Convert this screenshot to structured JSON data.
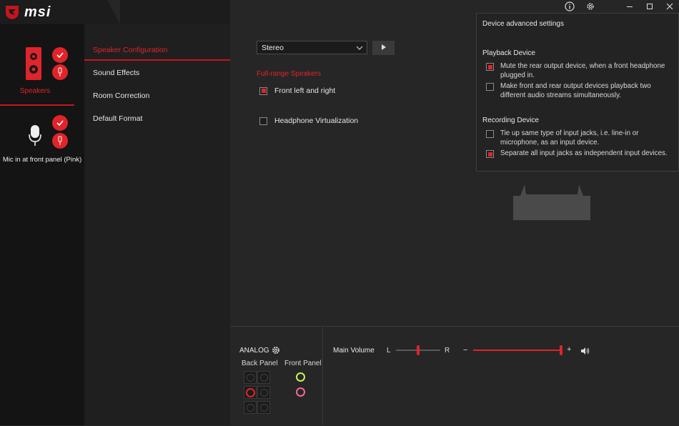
{
  "app": {
    "brand": "msi"
  },
  "window": {
    "info_icon": "info-icon",
    "settings_icon": "gear-icon",
    "minimize_icon": "minimize-icon",
    "maximize_icon": "maximize-icon",
    "close_icon": "close-icon"
  },
  "devices": [
    {
      "label": "Speakers",
      "active": true
    },
    {
      "label": "Mic in at front panel (Pink)",
      "active": false
    }
  ],
  "nav": {
    "items": [
      "Speaker Configuration",
      "Sound Effects",
      "Room Correction",
      "Default Format"
    ],
    "active_index": 0
  },
  "config": {
    "dropdown_value": "Stereo",
    "full_range_heading": "Full-range Speakers",
    "front_lr_label": "Front left and right",
    "front_lr_checked": true,
    "headphone_virt_label": "Headphone Virtualization",
    "headphone_virt_checked": false
  },
  "advanced": {
    "title": "Device advanced settings",
    "playback_heading": "Playback Device",
    "playback_opt1": "Mute the rear output device, when a front headphone plugged in.",
    "playback_opt1_checked": true,
    "playback_opt2": "Make front and rear output devices playback two different audio streams simultaneously.",
    "playback_opt2_checked": false,
    "recording_heading": "Recording Device",
    "recording_opt1": "Tie up same type of input jacks, i.e. line-in or microphone, as an input device.",
    "recording_opt1_checked": false,
    "recording_opt2": "Separate all input jacks as independent input devices.",
    "recording_opt2_checked": true
  },
  "bottom": {
    "analog_label": "ANALOG",
    "back_panel_label": "Back Panel",
    "front_panel_label": "Front Panel",
    "main_volume_label": "Main Volume",
    "balance_left": "L",
    "balance_right": "R",
    "volume_minus": "−",
    "volume_plus": "+",
    "balance_fraction": 0.5,
    "volume_fraction": 1.0
  },
  "colors": {
    "accent": "#e0242b",
    "jack_green": "#c6f25c",
    "jack_pink": "#f06a9a",
    "jack_red": "#e0242b"
  }
}
